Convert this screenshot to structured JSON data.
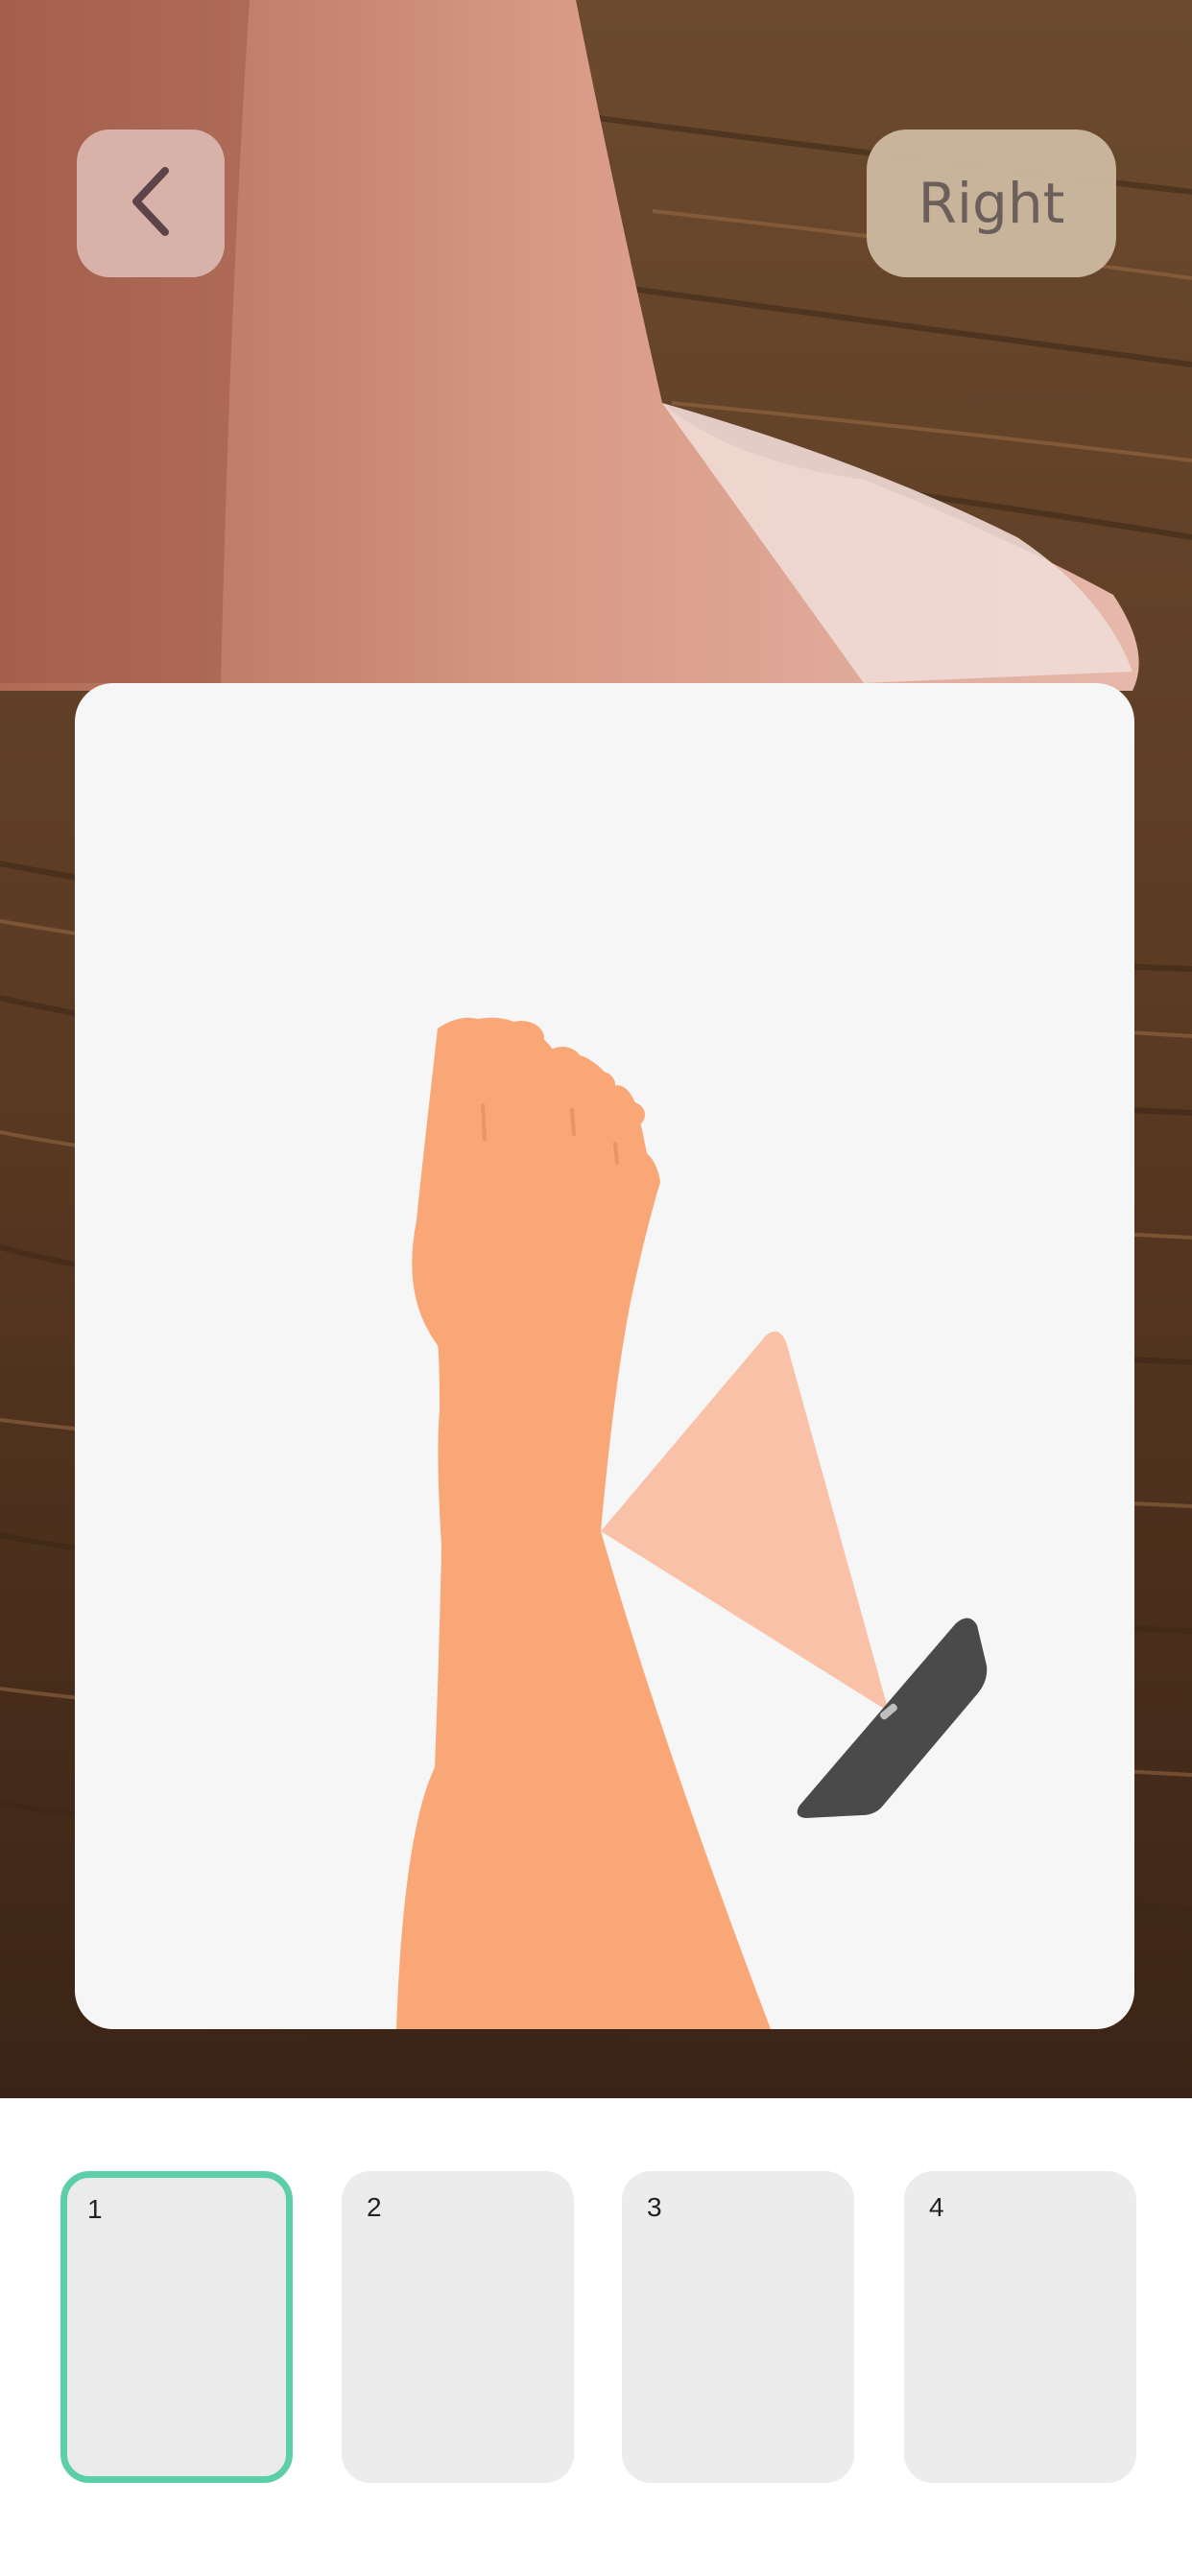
{
  "header": {
    "back_icon": "chevron-left-icon",
    "side_label": "Right"
  },
  "guide": {
    "illustration": "leg-and-phone-scan-illustration",
    "colors": {
      "skin": "#f9a776",
      "scan_cone": "#f9c2a8",
      "phone": "#4a4a4a",
      "card_background": "#f6f6f6"
    }
  },
  "thumbnails": {
    "selected_color": "#5ccfaa",
    "items": [
      {
        "label": "1"
      },
      {
        "label": "2"
      },
      {
        "label": "3"
      },
      {
        "label": "4"
      }
    ]
  }
}
